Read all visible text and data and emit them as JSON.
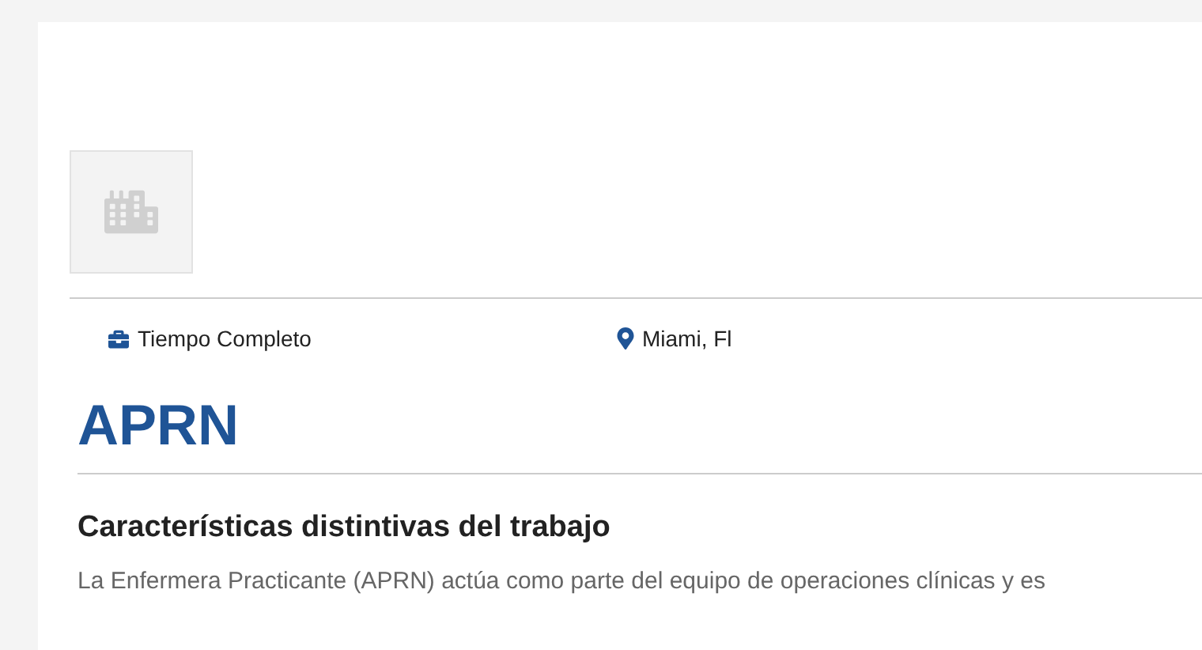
{
  "job": {
    "employment_type": "Tiempo Completo",
    "location": "Miami, Fl",
    "title": "APRN"
  },
  "section": {
    "heading": "Características distintivas del trabajo",
    "paragraph": "La Enfermera Practicante (APRN) actúa como parte del equipo de operaciones clínicas y es"
  }
}
